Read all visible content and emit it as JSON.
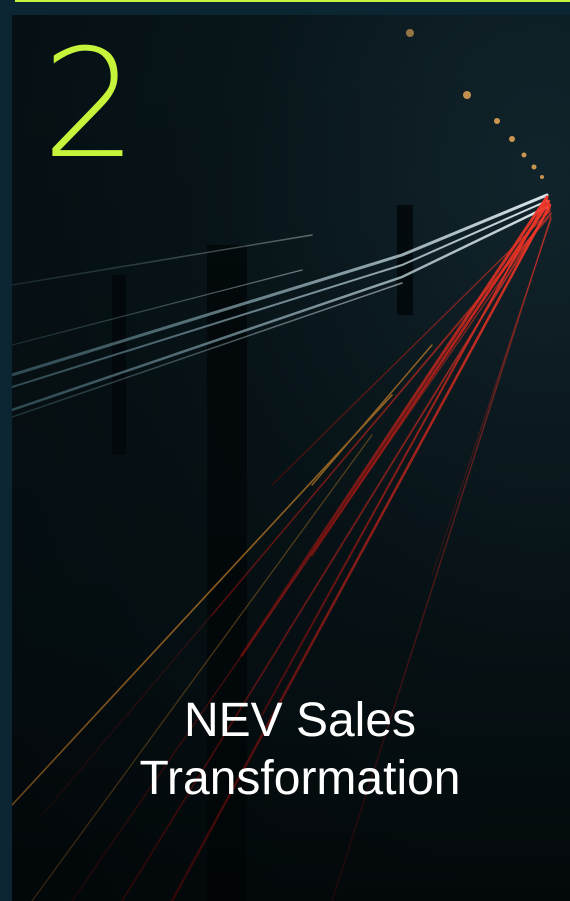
{
  "slide": {
    "number": "2",
    "title_line1": "NEV Sales",
    "title_line2": "Transformation"
  },
  "colors": {
    "accent": "#c6f43a",
    "frame": "#0b2532",
    "photo_dark": "#040c10",
    "light_trail_red": "#d01818",
    "light_trail_white": "#cfe6ee",
    "light_trail_amber": "#d88a2a"
  },
  "background": {
    "image_description_icon": "night-highway-light-trails-image"
  }
}
